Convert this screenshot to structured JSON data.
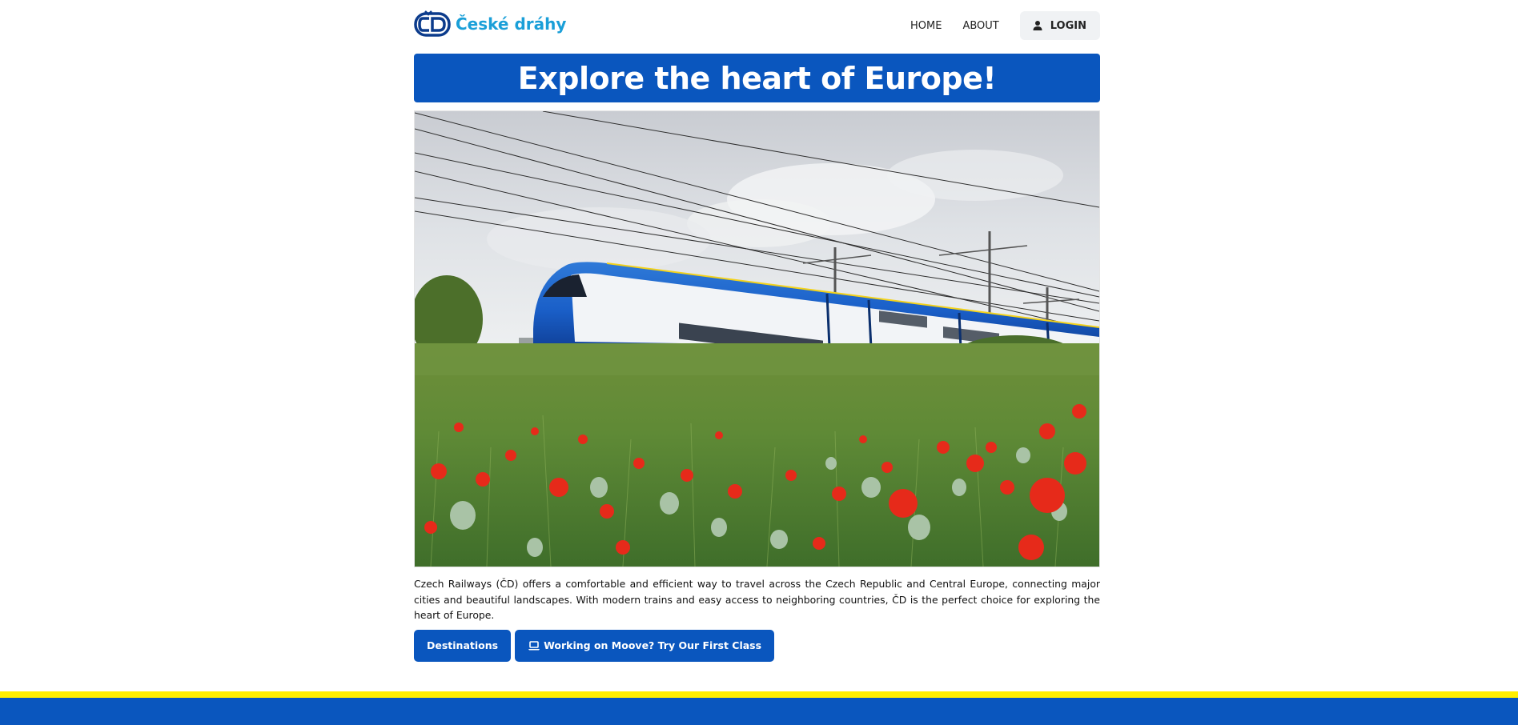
{
  "header": {
    "brand": "České dráhy",
    "logo_icon": "cd-logo-icon",
    "nav": {
      "home": "HOME",
      "about": "ABOUT",
      "login": "LOGIN",
      "login_icon": "user-icon"
    }
  },
  "banner": {
    "title": "Explore the heart of Europe!"
  },
  "hero": {
    "alt": "Blue ČD railjet train passing a field of red poppies under overhead catenary wires"
  },
  "main": {
    "description": "Czech Railways (ČD) offers a comfortable and efficient way to travel across the Czech Republic and Central Europe, connecting major cities and beautiful landscapes. With modern trains and easy access to neighboring countries, ČD is the perfect choice for exploring the heart of Europe.",
    "destinations_label": "Destinations",
    "first_class_label": "Working on Moove? Try Our First Class",
    "first_class_icon": "laptop-icon"
  },
  "colors": {
    "primary_blue": "#0a56be",
    "brand_cyan": "#1a9fd8",
    "footer_yellow": "#ffee00"
  }
}
